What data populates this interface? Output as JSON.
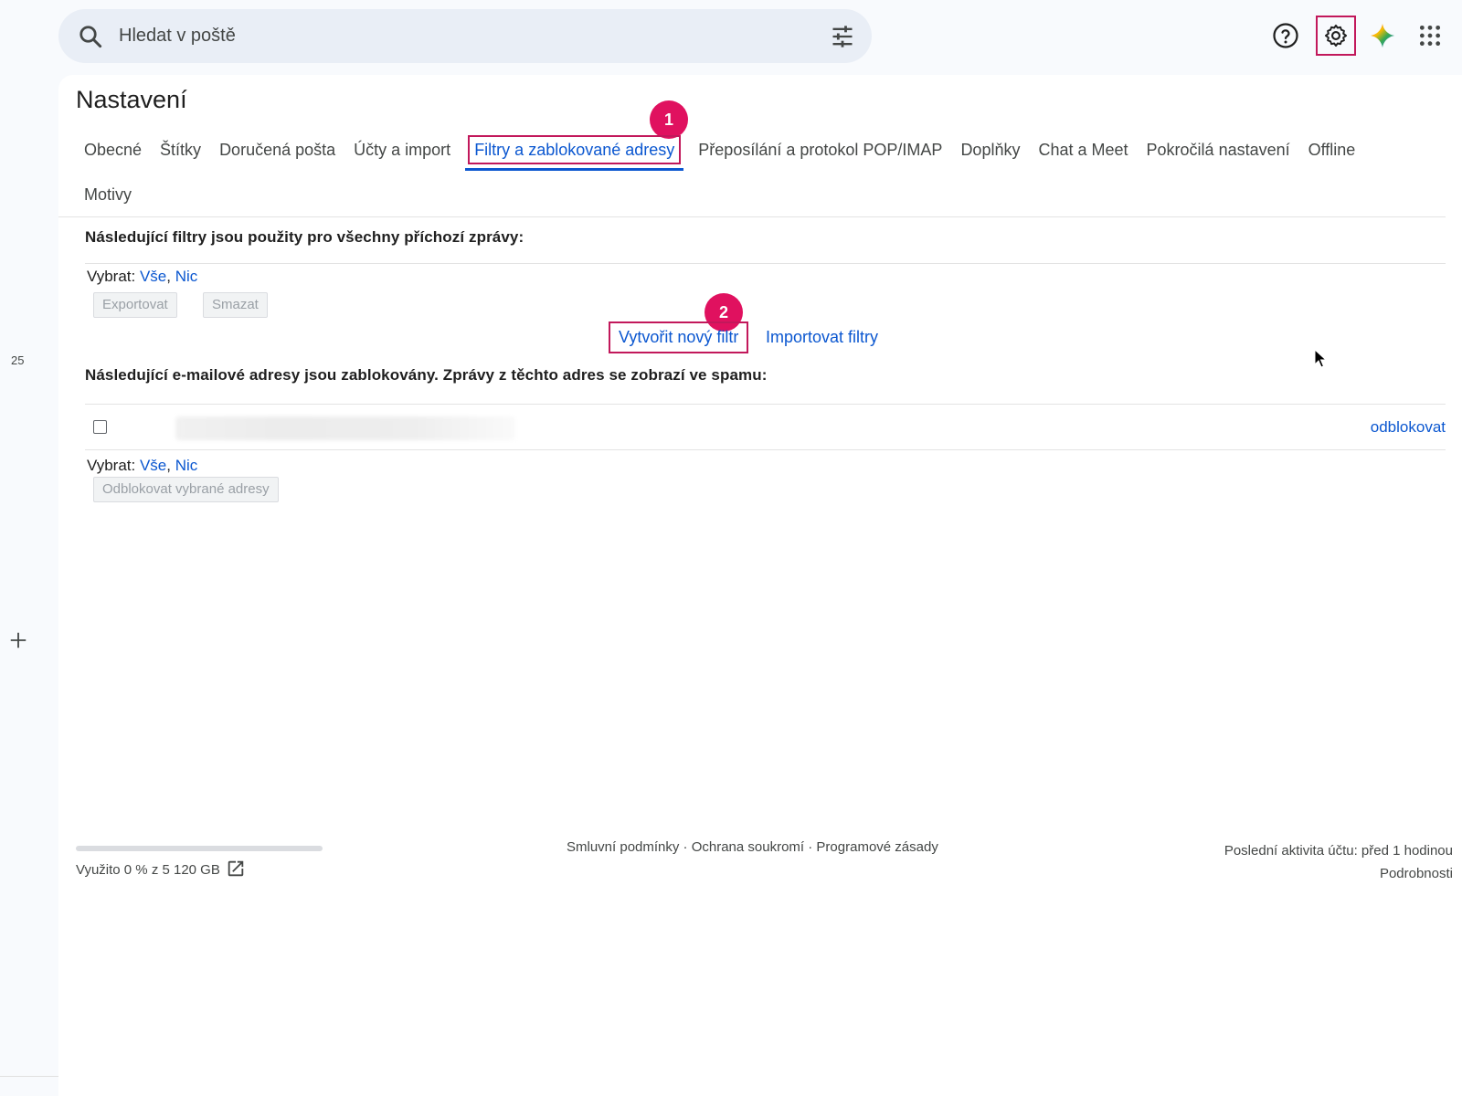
{
  "search": {
    "placeholder": "Hledat v poště",
    "icon": "search-icon",
    "options_icon": "tune-icon"
  },
  "header_icons": [
    "help-icon",
    "settings-icon",
    "gemini-icon",
    "apps-icon"
  ],
  "left_rail": {
    "count": "25",
    "add_icon": "plus-icon"
  },
  "settings": {
    "title": "Nastavení",
    "tabs_row1": [
      {
        "label": "Obecné"
      },
      {
        "label": "Štítky"
      },
      {
        "label": "Doručená pošta"
      },
      {
        "label": "Účty a import"
      },
      {
        "label": "Filtry a zablokované adresy",
        "active": true
      },
      {
        "label": "Přeposílání a protokol POP/IMAP"
      },
      {
        "label": "Doplňky"
      },
      {
        "label": "Chat a Meet"
      },
      {
        "label": "Pokročilá nastavení"
      },
      {
        "label": "Offline"
      }
    ],
    "tabs_row2": [
      {
        "label": "Motivy"
      }
    ]
  },
  "annotations": {
    "step1": "1",
    "step2": "2",
    "highlight_color": "#c2185b",
    "badge_color": "#e0115f"
  },
  "filters": {
    "heading": "Následující filtry jsou použity pro všechny příchozí zprávy:",
    "select_label": "Vybrat:",
    "select_all": "Vše",
    "select_none": "Nic",
    "export_button": "Exportovat",
    "delete_button": "Smazat",
    "create_new": "Vytvořit nový filtr",
    "import": "Importovat filtry"
  },
  "blocked": {
    "heading": "Následující e-mailové adresy jsou zablokovány. Zprávy z těchto adres se zobrazí ve spamu:",
    "unblock_link": "odblokovat",
    "select_label": "Vybrat:",
    "select_all": "Vše",
    "select_none": "Nic",
    "unblock_selected_button": "Odblokovat vybrané adresy"
  },
  "footer": {
    "storage_used": "Využito 0 % z 5 120 GB",
    "storage_fraction": 0,
    "links": "Smluvní podmínky · Ochrana soukromí · Programové zásady",
    "last_activity": "Poslední aktivita účtu: před 1 hodinou",
    "details": "Podrobnosti"
  },
  "colors": {
    "link": "#0b57d0",
    "search_bg": "#e9eef6",
    "page_bg": "#f8fafd"
  }
}
